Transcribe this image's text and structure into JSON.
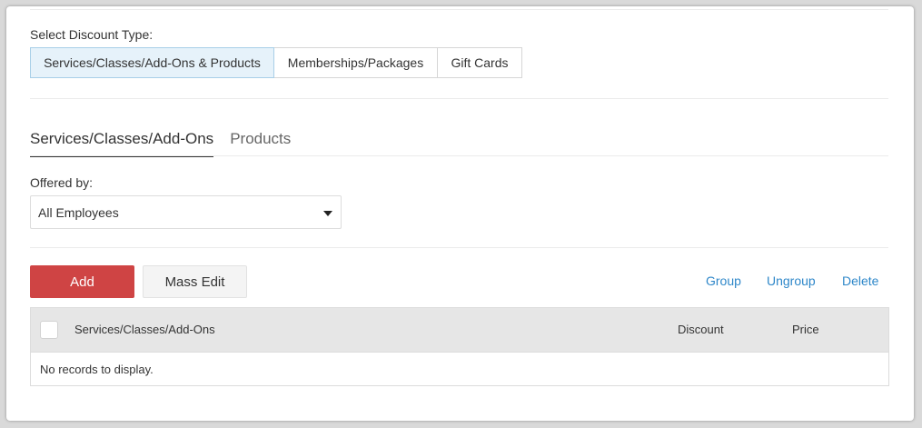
{
  "discount_type": {
    "label": "Select Discount Type:",
    "options": [
      "Services/Classes/Add-Ons & Products",
      "Memberships/Packages",
      "Gift Cards"
    ],
    "selected": "Services/Classes/Add-Ons & Products"
  },
  "tabs": [
    {
      "label": "Services/Classes/Add-Ons",
      "active": true
    },
    {
      "label": "Products",
      "active": false
    }
  ],
  "offered_by": {
    "label": "Offered by:",
    "value": "All Employees",
    "icon": "caret-down-icon"
  },
  "actions": {
    "add_label": "Add",
    "mass_edit_label": "Mass Edit",
    "group_label": "Group",
    "ungroup_label": "Ungroup",
    "delete_label": "Delete"
  },
  "table": {
    "columns": [
      "Services/Classes/Add-Ons",
      "Discount",
      "Price"
    ],
    "empty_message": "No records to display."
  },
  "colors": {
    "primary_button": "#cf4444",
    "link": "#2e87c9",
    "selected_segment": "#e6f2fa"
  }
}
